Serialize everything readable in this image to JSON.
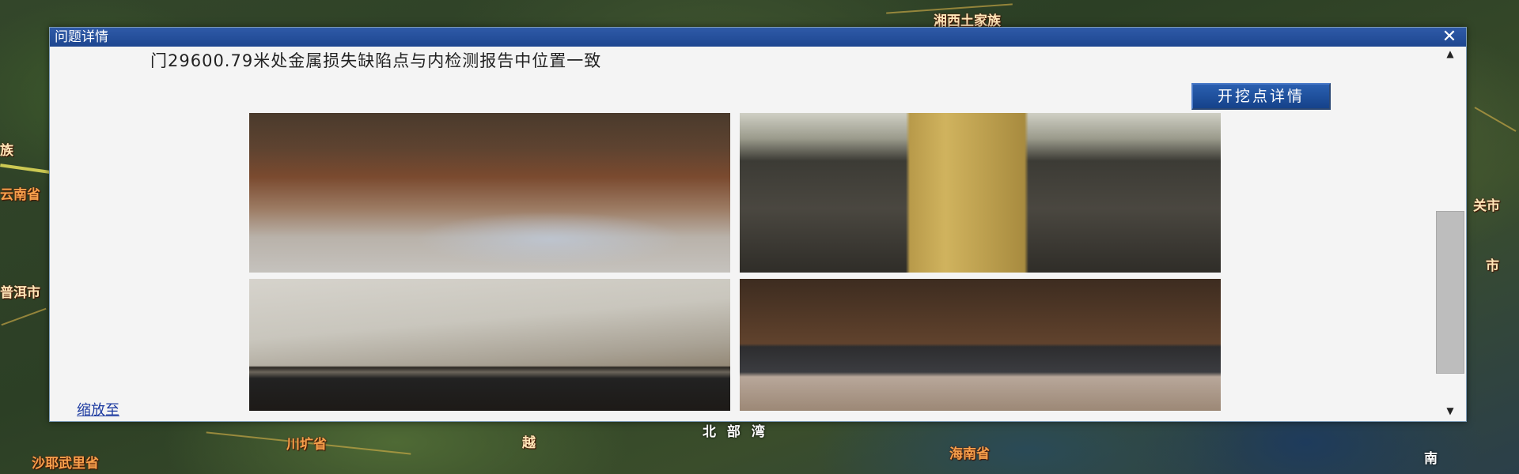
{
  "map": {
    "labels": [
      {
        "text": "湘西土家族",
        "style": "normal"
      },
      {
        "text": "族",
        "style": "normal"
      },
      {
        "text": "云南省",
        "style": "orange"
      },
      {
        "text": "普洱市",
        "style": "normal"
      },
      {
        "text": "沙耶武里省",
        "style": "orange"
      },
      {
        "text": "川圹省",
        "style": "orange"
      },
      {
        "text": "越",
        "style": "normal"
      },
      {
        "text": "北 部 湾",
        "style": "white"
      },
      {
        "text": "海南省",
        "style": "orange"
      },
      {
        "text": "关市",
        "style": "normal"
      },
      {
        "text": "市",
        "style": "normal"
      },
      {
        "text": "南",
        "style": "white"
      }
    ]
  },
  "dialog": {
    "title": "问题详情",
    "close_glyph": "✕",
    "description": "门29600.79米处金属损失缺陷点与内检测报告中位置一致",
    "excavation_button_label": "开挖点详情",
    "zoom_link": "缩放至",
    "scroll_up_glyph": "▲",
    "scroll_down_glyph": "▼"
  }
}
